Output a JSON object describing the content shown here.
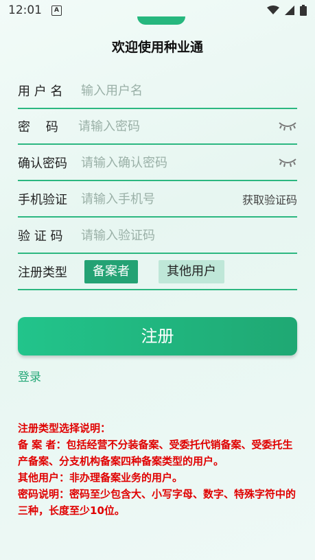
{
  "status_bar": {
    "time": "12:01",
    "a_badge": "A",
    "icons": [
      "wifi-icon",
      "signal-icon",
      "battery-icon"
    ]
  },
  "title": "欢迎使用种业通",
  "form": {
    "username": {
      "label": "用 户 名",
      "placeholder": "输入用户名"
    },
    "password": {
      "label": "密    码",
      "placeholder": "请输入密码"
    },
    "confirm": {
      "label": "确认密码",
      "placeholder": "请输入确认密码"
    },
    "phone": {
      "label": "手机验证",
      "placeholder": "请输入手机号",
      "action": "获取验证码"
    },
    "code": {
      "label": "验 证 码",
      "placeholder": "请输入验证码"
    },
    "reg_type": {
      "label": "注册类型",
      "options": [
        "备案者",
        "其他用户"
      ],
      "selected": "备案者"
    }
  },
  "register_button": "注册",
  "login_link": "登录",
  "notes": [
    "注册类型选择说明：",
    "备 案 者：包括经营不分装备案、受委托代销备案、受委托生产备案、分支机构备案四种备案类型的用户。",
    "其他用户：非办理备案业务的用户。",
    "密码说明：密码至少包含大、小写字母、数字、特殊字符中的三种，长度至少10位。"
  ],
  "colors": {
    "accent": "#26b77e",
    "note_red": "#e00000"
  }
}
